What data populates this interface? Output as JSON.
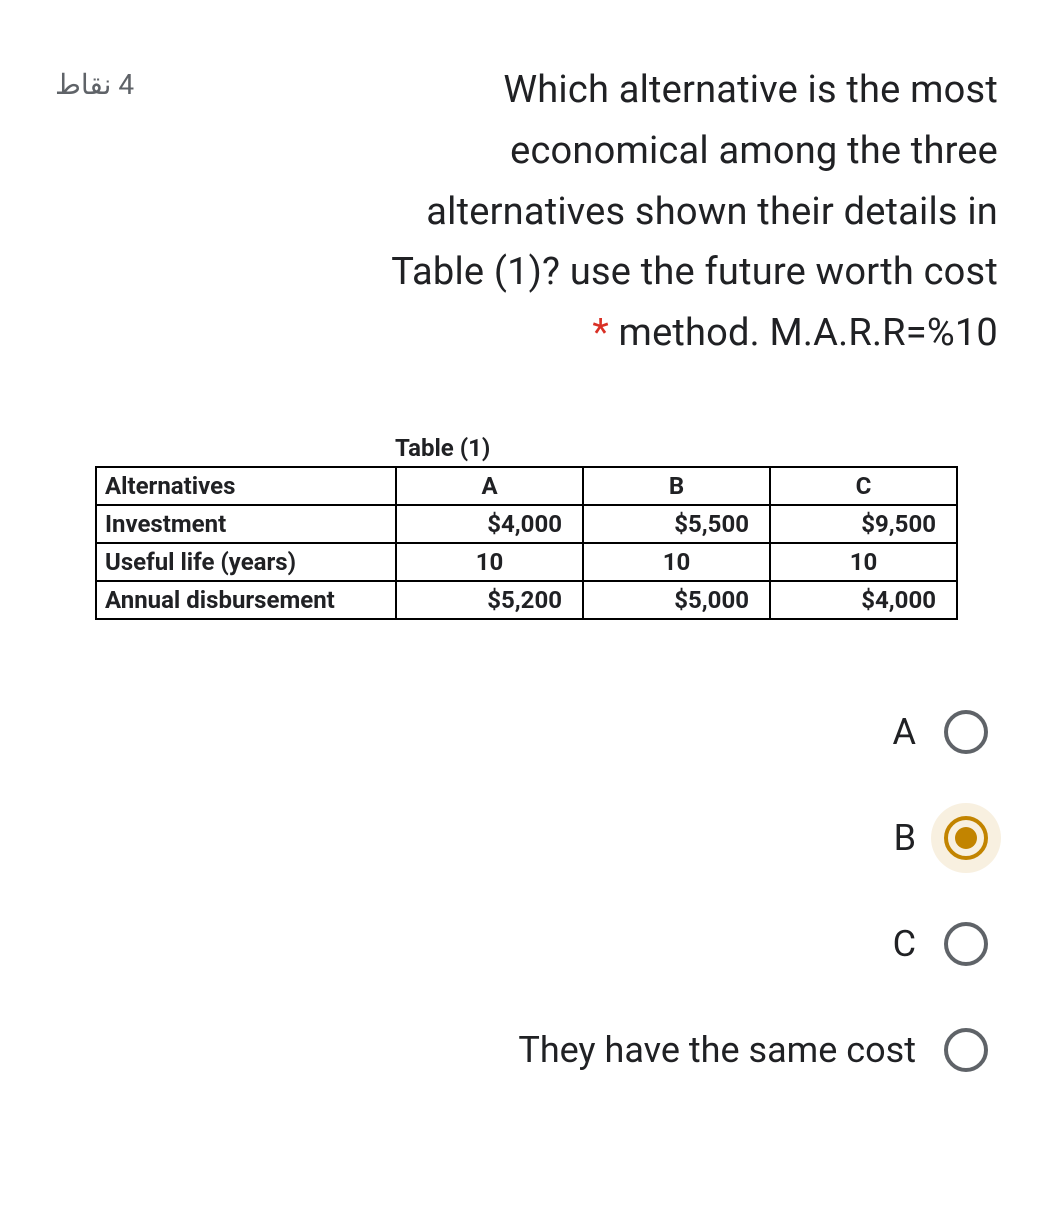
{
  "question": {
    "points_label": "4 نقاط",
    "text_line1": "Which alternative is the most",
    "text_line2": "economical among the three",
    "text_line3": "alternatives shown their details in",
    "text_line4": "Table (1)? use the future worth cost",
    "text_line5_after_asterisk": " method. M.A.R.R=%10",
    "asterisk": "*"
  },
  "table": {
    "title": "Table (1)",
    "rows": [
      {
        "label": "Alternatives",
        "a": "A",
        "b": "B",
        "c": "C",
        "align": "center"
      },
      {
        "label": "Investment",
        "a": "$4,000",
        "b": "$5,500",
        "c": "$9,500",
        "align": "right"
      },
      {
        "label": "Useful life (years)",
        "a": "10",
        "b": "10",
        "c": "10",
        "align": "center"
      },
      {
        "label": "Annual disbursement",
        "a": "$5,200",
        "b": "$5,000",
        "c": "$4,000",
        "align": "right"
      }
    ]
  },
  "options": [
    {
      "label": "A",
      "selected": false
    },
    {
      "label": "B",
      "selected": true
    },
    {
      "label": "C",
      "selected": false
    },
    {
      "label": "They have the same cost",
      "selected": false
    }
  ]
}
